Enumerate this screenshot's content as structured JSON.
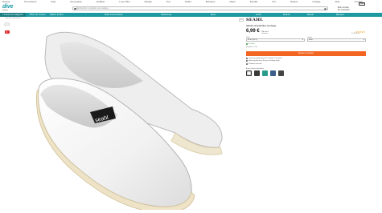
{
  "top_tabs": [
    "Divana",
    "Promotions",
    "Ikea",
    "Nouveauté",
    "Grafiker",
    "Luxe Plus",
    "Design",
    "Top",
    "Outlet",
    "Marques",
    "Idées",
    "Famille",
    "Pro",
    "Saison",
    "Vintage",
    "Aide",
    "Contact"
  ],
  "header": {
    "logo": "dive",
    "logo_sub": "by divana",
    "search_placeholder": "Rechercher un produit, une marque...",
    "account_line1": "Mon compte",
    "account_line2": "Se connecter",
    "cart_label": "Panier"
  },
  "nav": {
    "categories_button": "≡ Toutes les catégories",
    "deals_button": "Offres du moment",
    "items": [
      "Maison & Déco",
      "Mode & Accessoires",
      "Chaussures",
      "Sport",
      "Jardin",
      "Enfants",
      "Beauté",
      "Marques"
    ]
  },
  "breadcrumb": "Accueil › Chaussures",
  "zoom_label": "1/4",
  "product": {
    "brand": "SEAHL",
    "title": "SEAHL Espadrilles Heritage",
    "stars": "★★★★★",
    "reviews": "5,0 (12 avis)",
    "price": "6,99 €",
    "vat_line1": "TVA incluse",
    "vat_line2": "+ livraison",
    "size_label": "Taille",
    "size_value": "36 EU (UK 4)",
    "color_label": "Couleur",
    "color_value": "Blanc",
    "stock_text": "En stock",
    "stock_sub": "Expédié en 24h",
    "cart_button": "Ajouter au panier",
    "info_lines": [
      "Livraison gratuite dès 49 €, livraison 2 à 4 jours",
      "Retour gratuit sous 30 jours, échange facile",
      "Paiement sécurisé"
    ],
    "colors_label": "Autres couleurs disponibles",
    "swatch_colors": [
      "#f4f4f4",
      "#3a3a3a",
      "#2a9c8c",
      "#3b5f8a",
      "#444444"
    ]
  },
  "logo_text_on_shoe": "seahl",
  "colors": {
    "brand_teal": "#1d9aa1",
    "cta_orange": "#f26522",
    "star_yellow": "#f5a623"
  }
}
